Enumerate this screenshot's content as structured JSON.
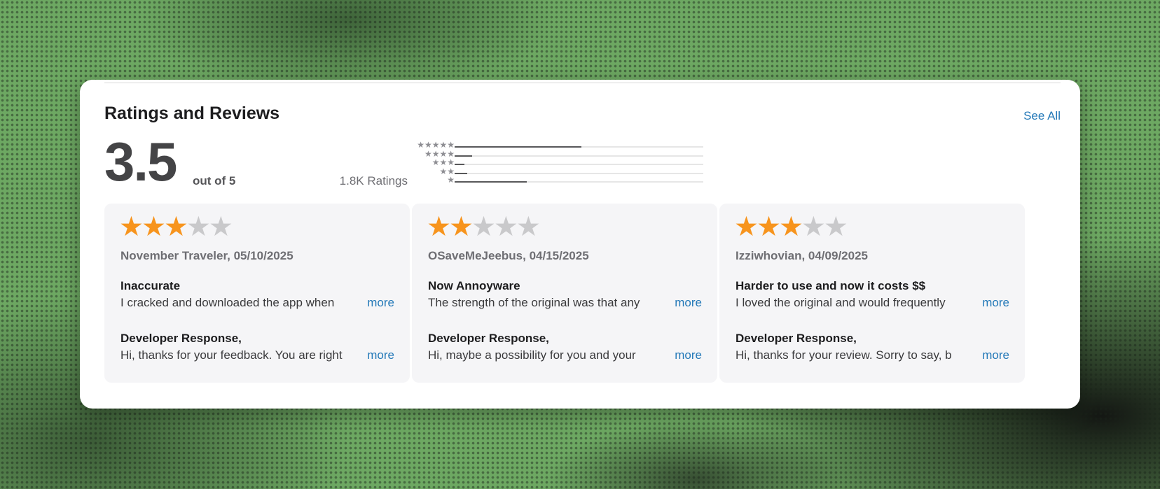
{
  "header": {
    "title": "Ratings and Reviews",
    "see_all": "See All"
  },
  "summary": {
    "average": "3.5",
    "out_of": "out of 5",
    "count_label": "1.8K Ratings",
    "histogram": [
      {
        "stars": "★★★★★",
        "fraction": 0.51
      },
      {
        "stars": "★★★★",
        "fraction": 0.07
      },
      {
        "stars": "★★★",
        "fraction": 0.04
      },
      {
        "stars": "★★",
        "fraction": 0.05
      },
      {
        "stars": "★",
        "fraction": 0.29
      }
    ]
  },
  "reviews": [
    {
      "rating": 3,
      "meta": "November Traveler, 05/10/2025",
      "title": "Inaccurate",
      "body": "I cracked and downloaded the app when",
      "response_label": "Developer Response,",
      "response": "Hi, thanks for your feedback. You are right",
      "more": "more"
    },
    {
      "rating": 2,
      "meta": "OSaveMeJeebus, 04/15/2025",
      "title": "Now Annoyware",
      "body": "The strength of the original was that any",
      "response_label": "Developer Response,",
      "response": "Hi, maybe a possibility for you and your",
      "more": "more"
    },
    {
      "rating": 3,
      "meta": "Izziwhovian, 04/09/2025",
      "title": "Harder to use and now it costs $$",
      "body": "I loved the original and would frequently",
      "response_label": "Developer Response,",
      "response": "Hi, thanks for your review. Sorry to say, b",
      "more": "more"
    }
  ],
  "colors": {
    "star_on": "#f7941d",
    "star_off": "#c9c9cb",
    "link": "#2479b8",
    "background": "#6da862"
  },
  "icons": {
    "rating_star": "star-icon"
  }
}
